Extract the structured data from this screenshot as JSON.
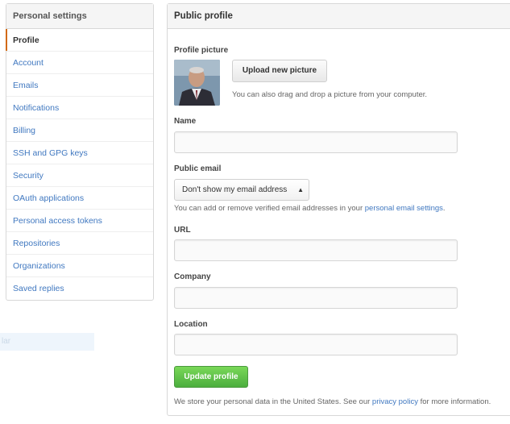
{
  "sidebar": {
    "title": "Personal settings",
    "items": [
      {
        "label": "Profile"
      },
      {
        "label": "Account"
      },
      {
        "label": "Emails"
      },
      {
        "label": "Notifications"
      },
      {
        "label": "Billing"
      },
      {
        "label": "SSH and GPG keys"
      },
      {
        "label": "Security"
      },
      {
        "label": "OAuth applications"
      },
      {
        "label": "Personal access tokens"
      },
      {
        "label": "Repositories"
      },
      {
        "label": "Organizations"
      },
      {
        "label": "Saved replies"
      }
    ],
    "selected": "Profile"
  },
  "ghost_text": "lar",
  "profile": {
    "title": "Public profile",
    "picture_label": "Profile picture",
    "upload_button": "Upload new picture",
    "upload_hint": "You can also drag and drop a picture from your computer.",
    "name_label": "Name",
    "name_value": "",
    "email_label": "Public email",
    "email_selected": "Don't show my email address",
    "email_hint_prefix": "You can add or remove verified email addresses in your ",
    "email_hint_link": "personal email settings",
    "email_hint_suffix": ".",
    "url_label": "URL",
    "url_value": "",
    "company_label": "Company",
    "company_value": "",
    "location_label": "Location",
    "location_value": "",
    "update_button": "Update profile",
    "footer_prefix": "We store your personal data in the United States. See our ",
    "footer_link": "privacy policy",
    "footer_suffix": " for more information."
  },
  "colors": {
    "link": "#4078c0",
    "selected_marker": "#d26911",
    "primary_button": "#5cb848"
  }
}
